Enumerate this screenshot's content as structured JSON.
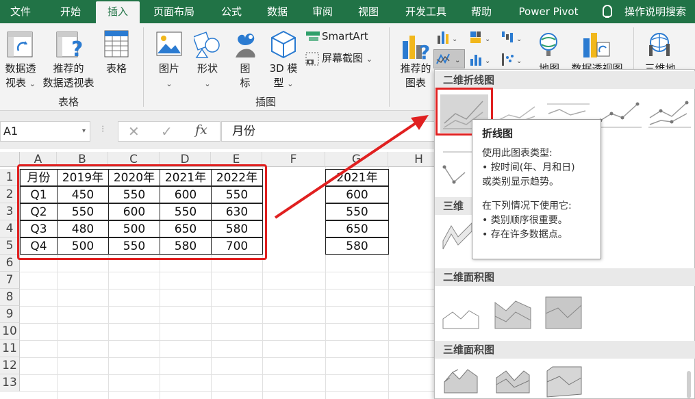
{
  "tabs": [
    {
      "label": "文件"
    },
    {
      "label": "开始"
    },
    {
      "label": "插入"
    },
    {
      "label": "页面布局"
    },
    {
      "label": "公式"
    },
    {
      "label": "数据"
    },
    {
      "label": "审阅"
    },
    {
      "label": "视图"
    },
    {
      "label": "开发工具"
    },
    {
      "label": "帮助"
    },
    {
      "label": "Power Pivot"
    }
  ],
  "active_tab": "插入",
  "tell_me": "操作说明搜索",
  "ribbon": {
    "pivot_table_line1": "数据透",
    "pivot_table_line2": "视表",
    "recommended_pivot_line1": "推荐的",
    "recommended_pivot_line2": "数据透视表",
    "table": "表格",
    "group_tables": "表格",
    "pictures": "图片",
    "shapes": "形状",
    "icons_line1": "图",
    "icons_line2": "标",
    "models_line1": "3D 模",
    "models_line2": "型",
    "smartart": "SmartArt",
    "screenshot": "屏幕截图",
    "group_illustrations": "插图",
    "recommended_charts_line1": "推荐的",
    "recommended_charts_line2": "图表",
    "maps": "地图",
    "pivot_chart": "数据透视图",
    "map3d": "三维地"
  },
  "formula_bar": {
    "name_box": "A1",
    "formula": "月份"
  },
  "sheet": {
    "columns": [
      "A",
      "B",
      "C",
      "D",
      "E",
      "F",
      "G",
      "H"
    ],
    "rows": [
      "1",
      "2",
      "3",
      "4",
      "5",
      "6",
      "7",
      "8",
      "9",
      "10",
      "11",
      "12",
      "13"
    ],
    "table_header": [
      "月份",
      "2019年",
      "2020年",
      "2021年",
      "2022年"
    ],
    "table_rows": [
      [
        "Q1",
        "450",
        "550",
        "600",
        "550"
      ],
      [
        "Q2",
        "550",
        "600",
        "550",
        "630"
      ],
      [
        "Q3",
        "480",
        "500",
        "650",
        "580"
      ],
      [
        "Q4",
        "500",
        "550",
        "580",
        "700"
      ]
    ],
    "g_header": "2021年",
    "g_values": [
      "600",
      "550",
      "650",
      "580"
    ]
  },
  "dropdown": {
    "line2d": "二维折线图",
    "line3d": "三维折",
    "area2d": "二维面积图",
    "area3d": "三维面积图"
  },
  "tooltip": {
    "title": "折线图",
    "line1": "使用此图表类型:",
    "line2": "• 按时间(年、月和日)",
    "line3": "或类别显示趋势。",
    "line4": "在下列情况下使用它:",
    "line5": "• 类别顺序很重要。",
    "line6": "• 存在许多数据点。"
  },
  "colors": {
    "excel_green": "#217346",
    "highlight_red": "#e02020"
  }
}
